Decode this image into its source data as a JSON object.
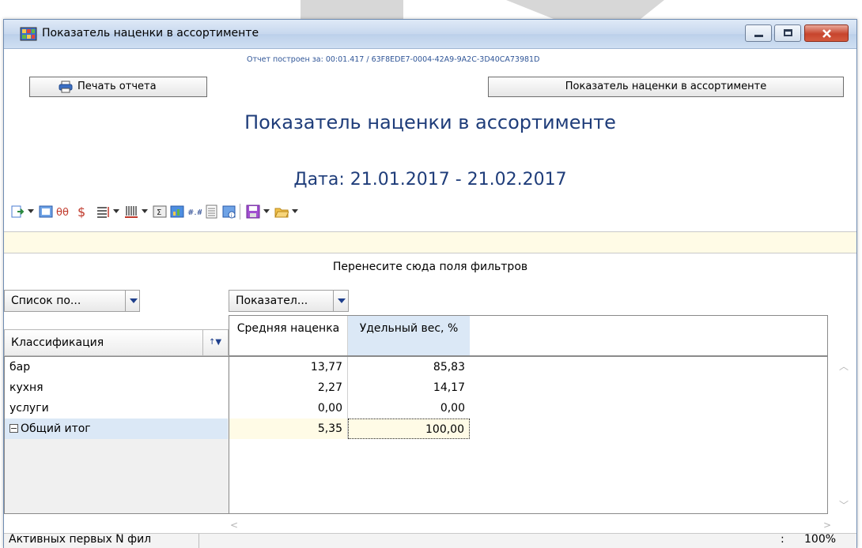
{
  "window": {
    "title": "Показатель наценки в ассортименте",
    "buttons": [
      "minimize",
      "maximize",
      "close"
    ]
  },
  "report_info": "Отчет построен за: 00:01.417 / 63F8EDE7-0004-42A9-9A2C-3D40CA73981D",
  "print_button_label": "Печать отчета",
  "title_button_label": "Показатель наценки в ассортименте",
  "report_title": "Показатель наценки в ассортименте",
  "report_date": "Дата: 21.01.2017 - 21.02.2017",
  "toolbar_icons": [
    "export-icon",
    "form-icon",
    "theta-icon",
    "dollar-icon",
    "align-icon",
    "bars-icon",
    "sigma-icon",
    "chart-icon",
    "decimal-icon",
    "list-icon",
    "info-icon",
    "save-icon",
    "open-folder-icon"
  ],
  "filter_hint": "Перенесите сюда поля фильтров",
  "row_field_button": "Список по...",
  "col_field_button": "Показател...",
  "row_header": "Классификация",
  "sort_icon_glyph": "↑▼",
  "column_headers": [
    "Средняя наценка",
    "Удельный вес, %"
  ],
  "rows": [
    {
      "label": "бар",
      "values": [
        "13,77",
        "85,83"
      ]
    },
    {
      "label": "кухня",
      "values": [
        "2,27",
        "14,17"
      ]
    },
    {
      "label": "услуги",
      "values": [
        "0,00",
        "0,00"
      ]
    }
  ],
  "total": {
    "label": "Общий итог",
    "values": [
      "5,35",
      "100,00"
    ]
  },
  "status": {
    "left": "Активных первых N фил",
    "colon": ":",
    "zoom": "100%"
  },
  "colors": {
    "title_blue": "#1f3d7a",
    "header_selected": "#dbe8f6",
    "total_cell": "#fffbe6"
  }
}
